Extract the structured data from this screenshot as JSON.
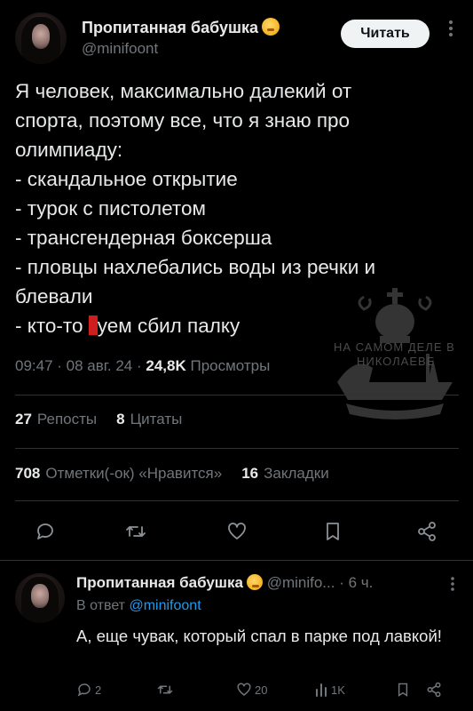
{
  "tweet": {
    "author_name": "Пропитанная бабушка",
    "author_handle": "@minifoont",
    "follow_label": "Читать",
    "body_lines": [
      "Я человек, максимально далекий от",
      "спорта, поэтому все, что я знаю про",
      "олимпиаду:",
      "- скандальное открытие",
      "- турок с пистолетом",
      "- трансгендерная боксерша",
      "- пловцы нахлебались воды из речки и",
      "блевали"
    ],
    "last_line_prefix": "- кто-то ",
    "last_line_suffix": "уем сбил палку",
    "time": "09:47",
    "date": "08 авг. 24",
    "views_count": "24,8K",
    "views_label": "Просмотры",
    "reposts_count": "27",
    "reposts_label": "Репосты",
    "quotes_count": "8",
    "quotes_label": "Цитаты",
    "likes_count": "708",
    "likes_label": "Отметки(-ок) «Нравится»",
    "bookmarks_count": "16",
    "bookmarks_label": "Закладки",
    "action_icons": [
      "reply-icon",
      "retweet-icon",
      "like-icon",
      "bookmark-icon",
      "share-icon"
    ]
  },
  "watermark": {
    "line1": "НА САМОМ ДЕЛЕ В",
    "line2": "НИКОЛАЕВЕ"
  },
  "reply": {
    "author_name": "Пропитанная бабушка",
    "author_handle": "@minifo...",
    "time": "· 6 ч.",
    "replying_to_prefix": "В ответ",
    "replying_to_handle": "@minifoont",
    "text": "А, еще чувак, который спал в парке под лавкой!",
    "replies": "2",
    "retweets": "",
    "likes": "20",
    "views": "1K"
  },
  "colors": {
    "background": "#000000",
    "text": "#e7e9ea",
    "secondary": "#71767b",
    "link": "#1d9bf0",
    "divider": "#2f3336"
  }
}
